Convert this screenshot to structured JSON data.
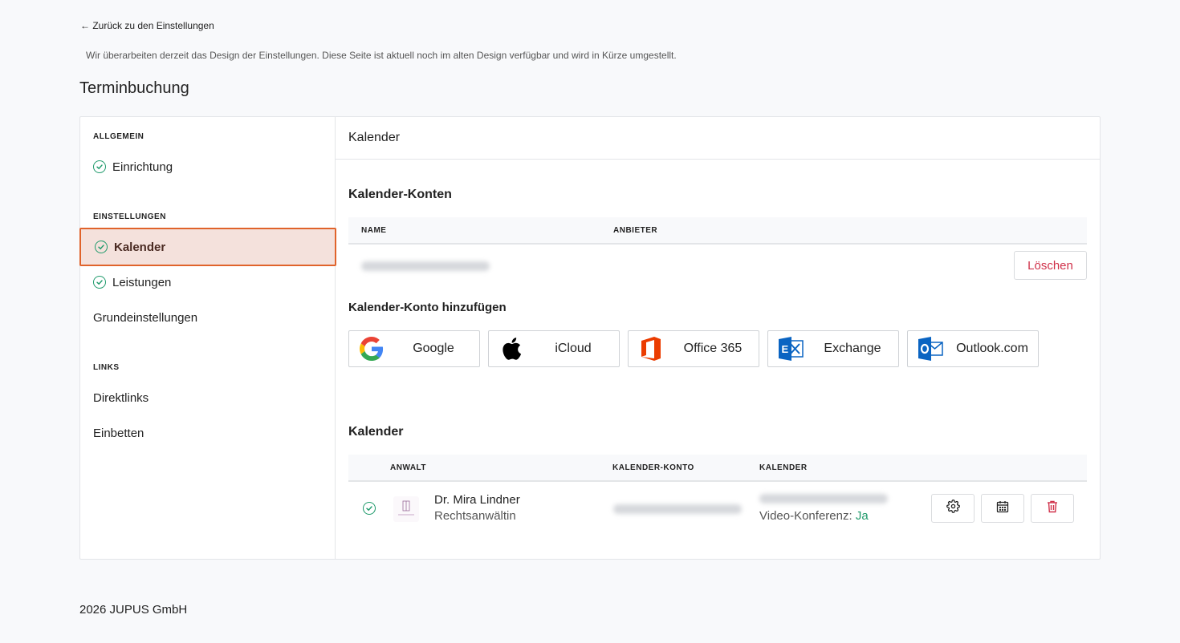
{
  "back_link": "← Zurück zu den Einstellungen",
  "notice": "Wir überarbeiten derzeit das Design der Einstellungen. Diese Seite ist aktuell noch im alten Design verfügbar und wird in Kürze umgestellt.",
  "page_title": "Terminbuchung",
  "sidebar": {
    "section_general": "ALLGEMEIN",
    "setup": "Einrichtung",
    "section_settings": "EINSTELLUNGEN",
    "calendar": "Kalender",
    "services": "Leistungen",
    "basic_settings": "Grundeinstellungen",
    "section_links": "LINKS",
    "direct_links": "Direktlinks",
    "embed": "Einbetten"
  },
  "main": {
    "header": "Kalender",
    "accounts_title": "Kalender-Konten",
    "accounts_table": {
      "col_name": "NAME",
      "col_provider": "ANBIETER",
      "delete_label": "Löschen"
    },
    "add_account_title": "Kalender-Konto hinzufügen",
    "providers": {
      "google": "Google",
      "icloud": "iCloud",
      "office365": "Office 365",
      "exchange": "Exchange",
      "outlook": "Outlook.com"
    },
    "calendars_title": "Kalender",
    "calendars_table": {
      "col_lawyer": "ANWALT",
      "col_account": "KALENDER-KONTO",
      "col_calendar": "KALENDER"
    },
    "calendar_row": {
      "name": "Dr. Mira Lindner",
      "role": "Rechtsanwältin",
      "video_label": "Video-Konferenz:",
      "video_value": "Ja"
    }
  },
  "footer": "2026 JUPUS GmbH",
  "colors": {
    "accent": "#e0632b",
    "active_bg": "#f4e1dc",
    "success": "#1f9a6b",
    "danger": "#d0314a"
  }
}
